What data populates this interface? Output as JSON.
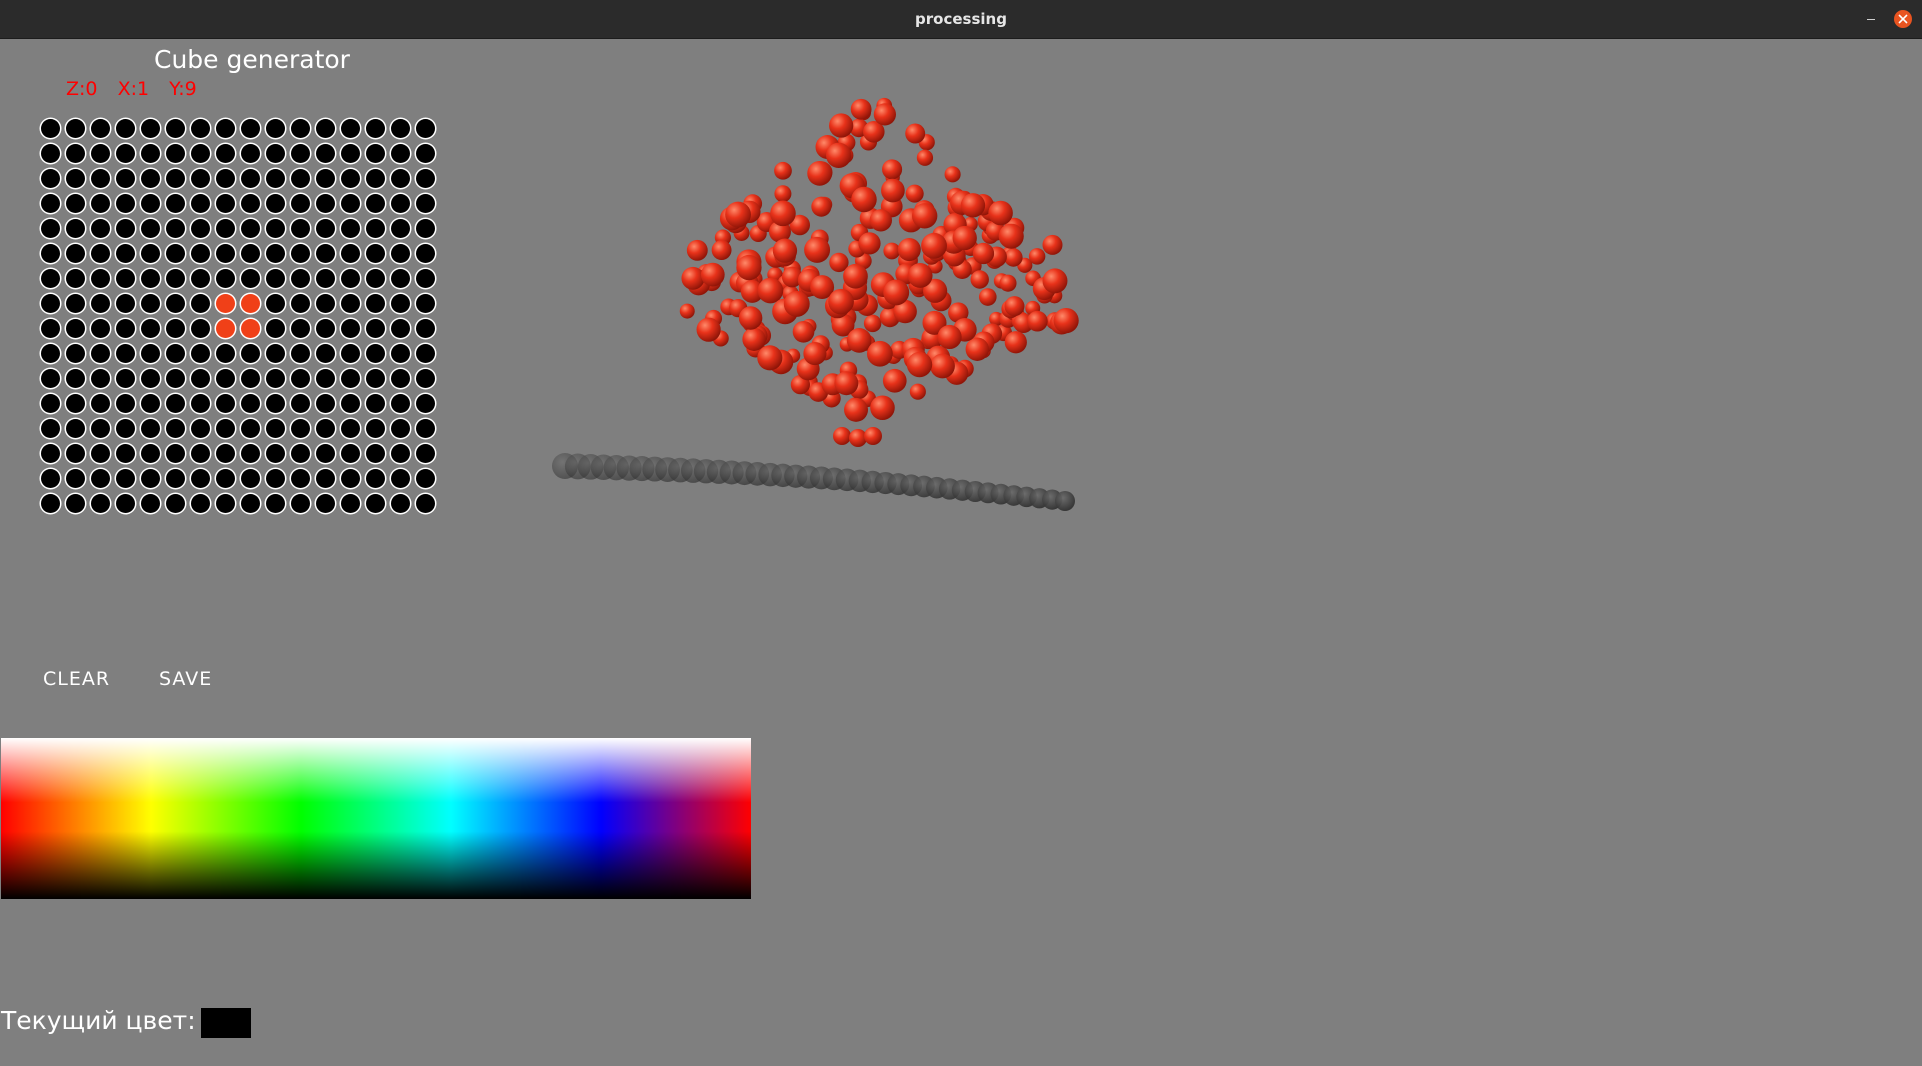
{
  "window": {
    "title": "processing"
  },
  "app": {
    "title": "Cube generator",
    "coords": {
      "z": "Z:0",
      "x": "X:1",
      "y": "Y:9"
    }
  },
  "grid": {
    "rows": 16,
    "cols": 16,
    "active_cells": [
      [
        7,
        7
      ],
      [
        7,
        8
      ],
      [
        8,
        7
      ],
      [
        8,
        8
      ]
    ],
    "off_color": "#000000",
    "on_color": "#f04018"
  },
  "buttons": {
    "clear": "CLEAR",
    "save": "SAVE"
  },
  "current_color": {
    "label": "Текущий цвет:",
    "value": "#000000"
  },
  "colors": {
    "background": "#7f7f7f",
    "accent": "#ff0000",
    "sphere": "#e8321a"
  }
}
